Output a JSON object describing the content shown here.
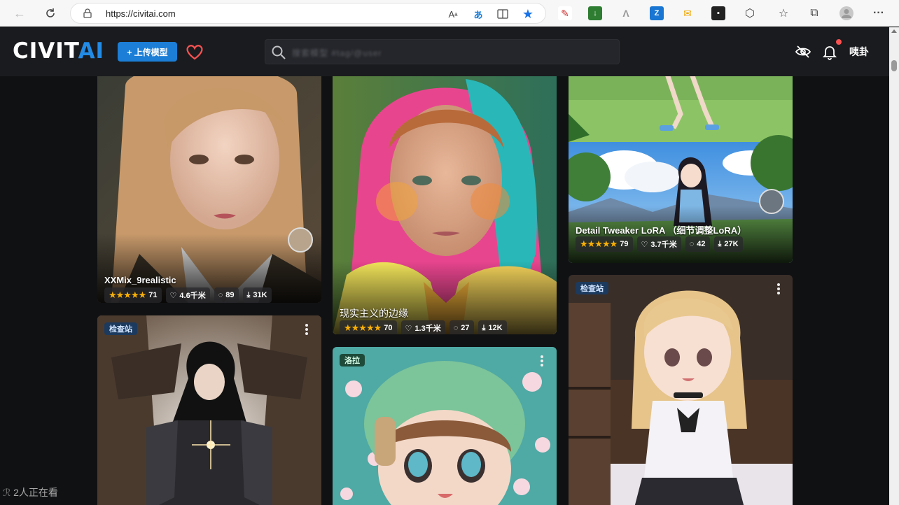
{
  "browser": {
    "url": "https://civitai.com",
    "address_icons": [
      "read-aloud-icon",
      "translate-icon",
      "reader-view-icon",
      "favorite-star-icon"
    ],
    "extensions": [
      "ext-red-icon",
      "ext-green-icon",
      "ext-gray-icon",
      "ext-blue-icon",
      "ext-yellow-icon",
      "ext-dark-icon"
    ],
    "toolbar_icons": [
      "extensions-icon",
      "favorites-icon",
      "collections-icon",
      "profile-icon",
      "more-icon"
    ]
  },
  "site": {
    "logo_left": "CIVIT",
    "logo_right": "AI",
    "upload_label": "+ 上传模型",
    "search_placeholder": "搜索模型   #tag/@user",
    "user_label": "咦卦",
    "accent": "#1c7ed6"
  },
  "cards": [
    {
      "title": "XXMix_9realistic",
      "stars": "★★★★★",
      "rating_count": "71",
      "likes": "4.6千米",
      "comments": "89",
      "downloads": "31K"
    },
    {
      "title": "现实主义的边缘",
      "stars": "★★★★★",
      "rating_count": "70",
      "likes": "1.3千米",
      "comments": "27",
      "downloads": "12K"
    },
    {
      "title": "Detail Tweaker LoRA （细节调整LoRA）",
      "stars": "★★★★★",
      "rating_count": "79",
      "likes": "3.7千米",
      "comments": "42",
      "downloads": "27K"
    },
    {
      "badge": "检查站"
    },
    {
      "badge": "洛拉"
    },
    {
      "badge": "检查站"
    }
  ],
  "watchers": "2人正在看"
}
